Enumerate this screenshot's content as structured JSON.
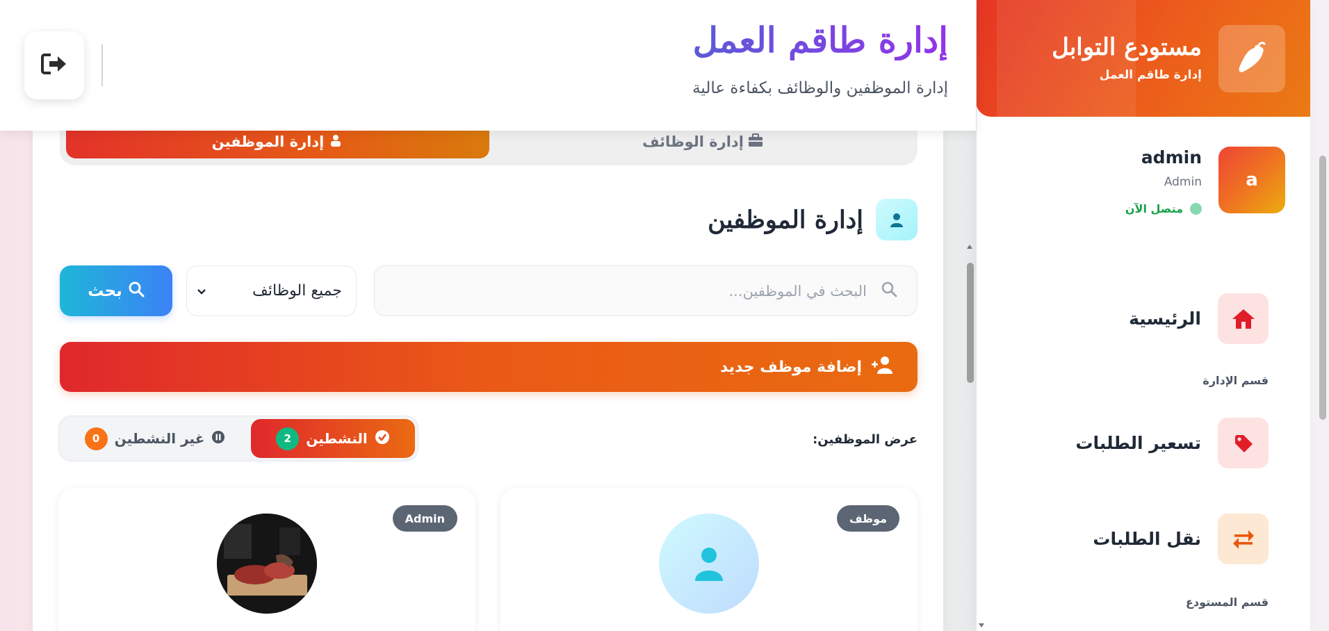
{
  "sidebar": {
    "brand_title": "مستودع التوابل",
    "brand_subtitle": "إدارة طاقم العمل",
    "user": {
      "avatar_letter": "a",
      "name": "admin",
      "role": "Admin",
      "status": "متصل الآن"
    },
    "nav": {
      "home": "الرئيسية",
      "section_admin": "قسم الإدارة",
      "pricing": "تسعير الطلبات",
      "transfer": "نقل الطلبات",
      "section_warehouse": "قسم المستودع"
    }
  },
  "header": {
    "title": "إدارة طاقم العمل",
    "subtitle": "إدارة الموظفين والوظائف بكفاءة عالية"
  },
  "main": {
    "tabs": {
      "employees": "إدارة الموظفين",
      "jobs": "إدارة الوظائف"
    },
    "section_title": "إدارة الموظفين",
    "search_placeholder": "البحث في الموظفين...",
    "filter_selected": "جميع الوظائف",
    "search_button": "بحث",
    "add_button": "إضافة موظف جديد",
    "view_label": "عرض الموظفين:",
    "toggle": {
      "active_label": "النشطين",
      "active_count": "2",
      "inactive_label": "غير النشطين",
      "inactive_count": "0"
    },
    "cards": [
      {
        "badge": "موظف"
      },
      {
        "badge": "Admin"
      }
    ]
  },
  "colors": {
    "brand_gradient_start": "#e53524",
    "brand_gradient_end": "#eb7a14",
    "accent_purple": "#7c3aed",
    "search_blue": "#3b82f6",
    "active_green": "#10b981",
    "inactive_orange": "#f97316"
  }
}
